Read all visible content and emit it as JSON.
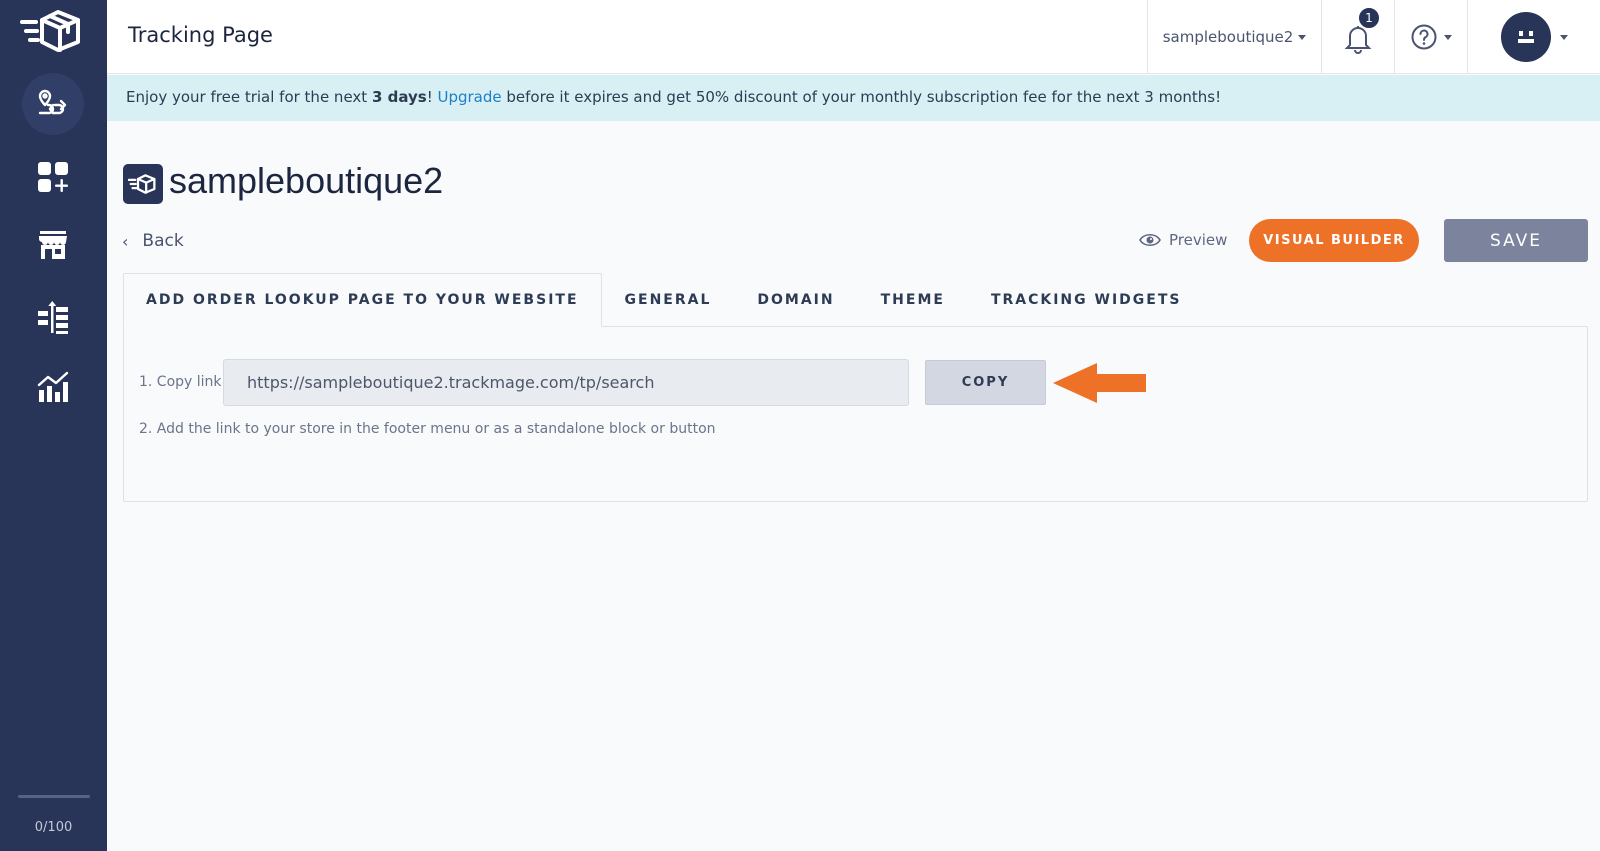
{
  "header": {
    "title": "Tracking Page",
    "store_select": "sampleboutique2",
    "notification_count": "1"
  },
  "banner": {
    "prefix": "Enjoy your free trial for the next ",
    "days": "3 days",
    "after_days": "! ",
    "upgrade_link": "Upgrade",
    "suffix": " before it expires and get 50% discount of your monthly subscription fee for the next 3 months!"
  },
  "sidebar": {
    "items": [
      {
        "icon": "route-icon",
        "active": true
      },
      {
        "icon": "add-widget-icon",
        "active": false
      },
      {
        "icon": "store-icon",
        "active": false
      },
      {
        "icon": "hierarchy-icon",
        "active": false
      },
      {
        "icon": "analytics-icon",
        "active": false
      }
    ],
    "usage": "0/100"
  },
  "store": {
    "name": "sampleboutique2"
  },
  "toolbar": {
    "back_label": "Back",
    "preview_label": "Preview",
    "visual_builder_label": "VISUAL BUILDER",
    "save_label": "SAVE"
  },
  "tabs": [
    {
      "label": "ADD ORDER LOOKUP PAGE TO YOUR WEBSITE",
      "active": true
    },
    {
      "label": "GENERAL",
      "active": false
    },
    {
      "label": "DOMAIN",
      "active": false
    },
    {
      "label": "THEME",
      "active": false
    },
    {
      "label": "TRACKING WIDGETS",
      "active": false
    }
  ],
  "lookup": {
    "step1_label": "1. Copy link",
    "link_value": "https://sampleboutique2.trackmage.com/tp/search",
    "copy_label": "COPY",
    "step2_text": "2. Add the link to your store in the footer menu or as a standalone block or button"
  },
  "colors": {
    "sidebar": "#283458",
    "accent_orange": "#ee7128",
    "save_button": "#7b849c",
    "banner_bg": "#d8f0f3",
    "link_blue": "#1c7fc7"
  }
}
